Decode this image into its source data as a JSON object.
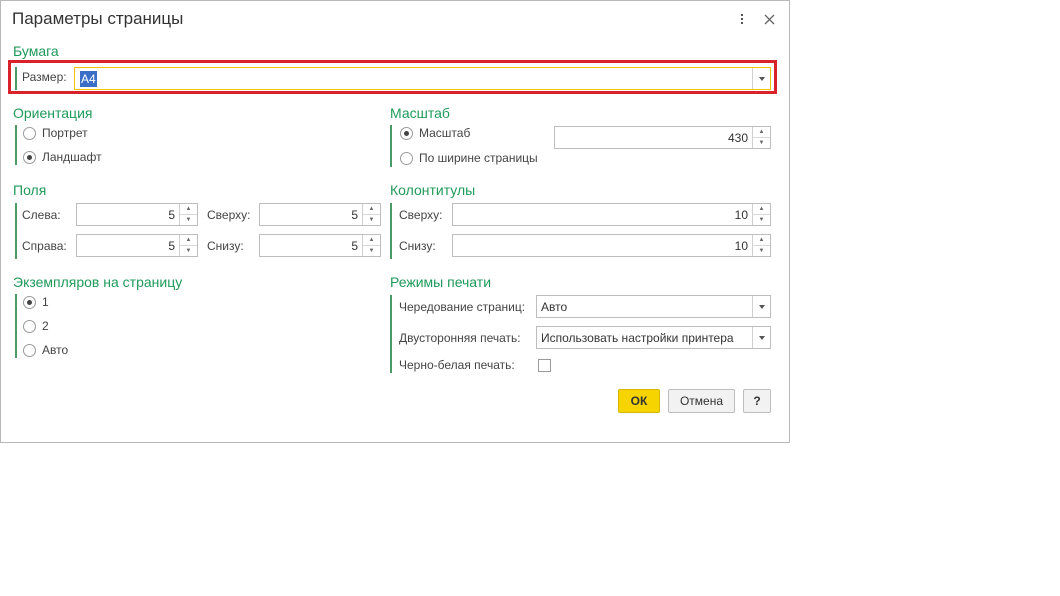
{
  "dialog": {
    "title": "Параметры страницы",
    "menu_icon": "more-vertical-icon",
    "close_icon": "close-icon"
  },
  "paper": {
    "title": "Бумага",
    "size_label": "Размер:",
    "size_value": "A4"
  },
  "orientation": {
    "title": "Ориентация",
    "options": [
      {
        "label": "Портрет",
        "selected": false
      },
      {
        "label": "Ландшафт",
        "selected": true
      }
    ]
  },
  "scale": {
    "title": "Масштаб",
    "scale_option": "Масштаб",
    "scale_selected": true,
    "fit_width_option": "По ширине страницы",
    "fit_width_selected": false,
    "scale_value": "430"
  },
  "margins": {
    "title": "Поля",
    "left_label": "Слева:",
    "left_value": "5",
    "top_label": "Сверху:",
    "top_value": "5",
    "right_label": "Справа:",
    "right_value": "5",
    "bottom_label": "Снизу:",
    "bottom_value": "5"
  },
  "headers": {
    "title": "Колонтитулы",
    "top_label": "Сверху:",
    "top_value": "10",
    "bottom_label": "Снизу:",
    "bottom_value": "10"
  },
  "copies": {
    "title": "Экземпляров на страницу",
    "options": [
      {
        "label": "1",
        "selected": true
      },
      {
        "label": "2",
        "selected": false
      },
      {
        "label": "Авто",
        "selected": false
      }
    ]
  },
  "print_modes": {
    "title": "Режимы печати",
    "alternation_label": "Чередование страниц:",
    "alternation_value": "Авто",
    "duplex_label": "Двусторонняя печать:",
    "duplex_value": "Использовать настройки принтера",
    "bw_label": "Черно-белая печать:",
    "bw_checked": false
  },
  "buttons": {
    "ok": "ОК",
    "cancel": "Отмена",
    "help": "?"
  },
  "colors": {
    "group_title": "#1f9a5a",
    "highlight": "#d9232b",
    "ok_button": "#f5d400",
    "selection": "#3b6fc7"
  }
}
